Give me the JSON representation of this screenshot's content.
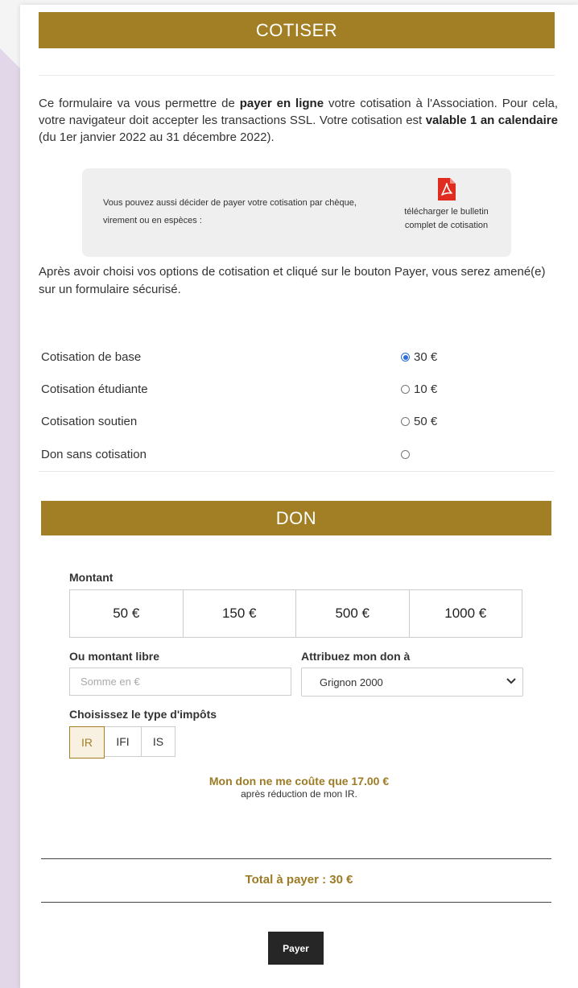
{
  "cotiser": {
    "title": "COTISER",
    "intro_1": "Ce formulaire va vous permettre de ",
    "intro_bold_1": "payer en ligne",
    "intro_2": " votre cotisation à l'Association. Pour cela, votre navigateur doit accepter les transactions SSL. Votre cotisation est ",
    "intro_bold_2": "valable 1 an calendaire",
    "intro_3": " (du 1er janvier 2022 au 31 décembre 2022).",
    "alt_payment_text": "Vous pouvez aussi décider de payer votre cotisation par chèque, virement ou en espèces :",
    "download_link": "télécharger le bulletin complet de cotisation",
    "instructions": "Après avoir choisi vos options de cotisation et cliqué sur le bouton Payer, vous serez amené(e) sur un formulaire sécurisé.",
    "options": [
      {
        "label": "Cotisation de base",
        "amount": "30 €",
        "checked": true
      },
      {
        "label": "Cotisation étudiante",
        "amount": "10 €",
        "checked": false
      },
      {
        "label": "Cotisation soutien",
        "amount": "50 €",
        "checked": false
      },
      {
        "label": "Don sans cotisation",
        "amount": "",
        "checked": false
      }
    ]
  },
  "don": {
    "title": "DON",
    "amount_label": "Montant",
    "amounts": [
      "50 €",
      "150 €",
      "500 €",
      "1000 €"
    ],
    "free_amount_label": "Ou montant libre",
    "free_amount_placeholder": "Somme en €",
    "free_amount_value": "",
    "attribution_label": "Attribuez mon don à",
    "attribution_selected": "Grignon 2000",
    "tax_type_label": "Choisissez le type d'impôts",
    "tax_types": [
      "IR",
      "IFI",
      "IS"
    ],
    "tax_selected": "IR",
    "savings_main": "Mon don ne me coûte que 17.00 €",
    "savings_sub": "après réduction de mon IR."
  },
  "total": "Total à payer : 30 €",
  "pay_button": "Payer",
  "colors": {
    "accent_gold": "#a27f24",
    "pay_button_bg": "#262626",
    "radio_checked": "#2a6fd6",
    "side_decoration": "#e2d6e9"
  },
  "icons": {
    "pdf": "pdf-icon",
    "select_chevron": "chevron-down-icon"
  }
}
